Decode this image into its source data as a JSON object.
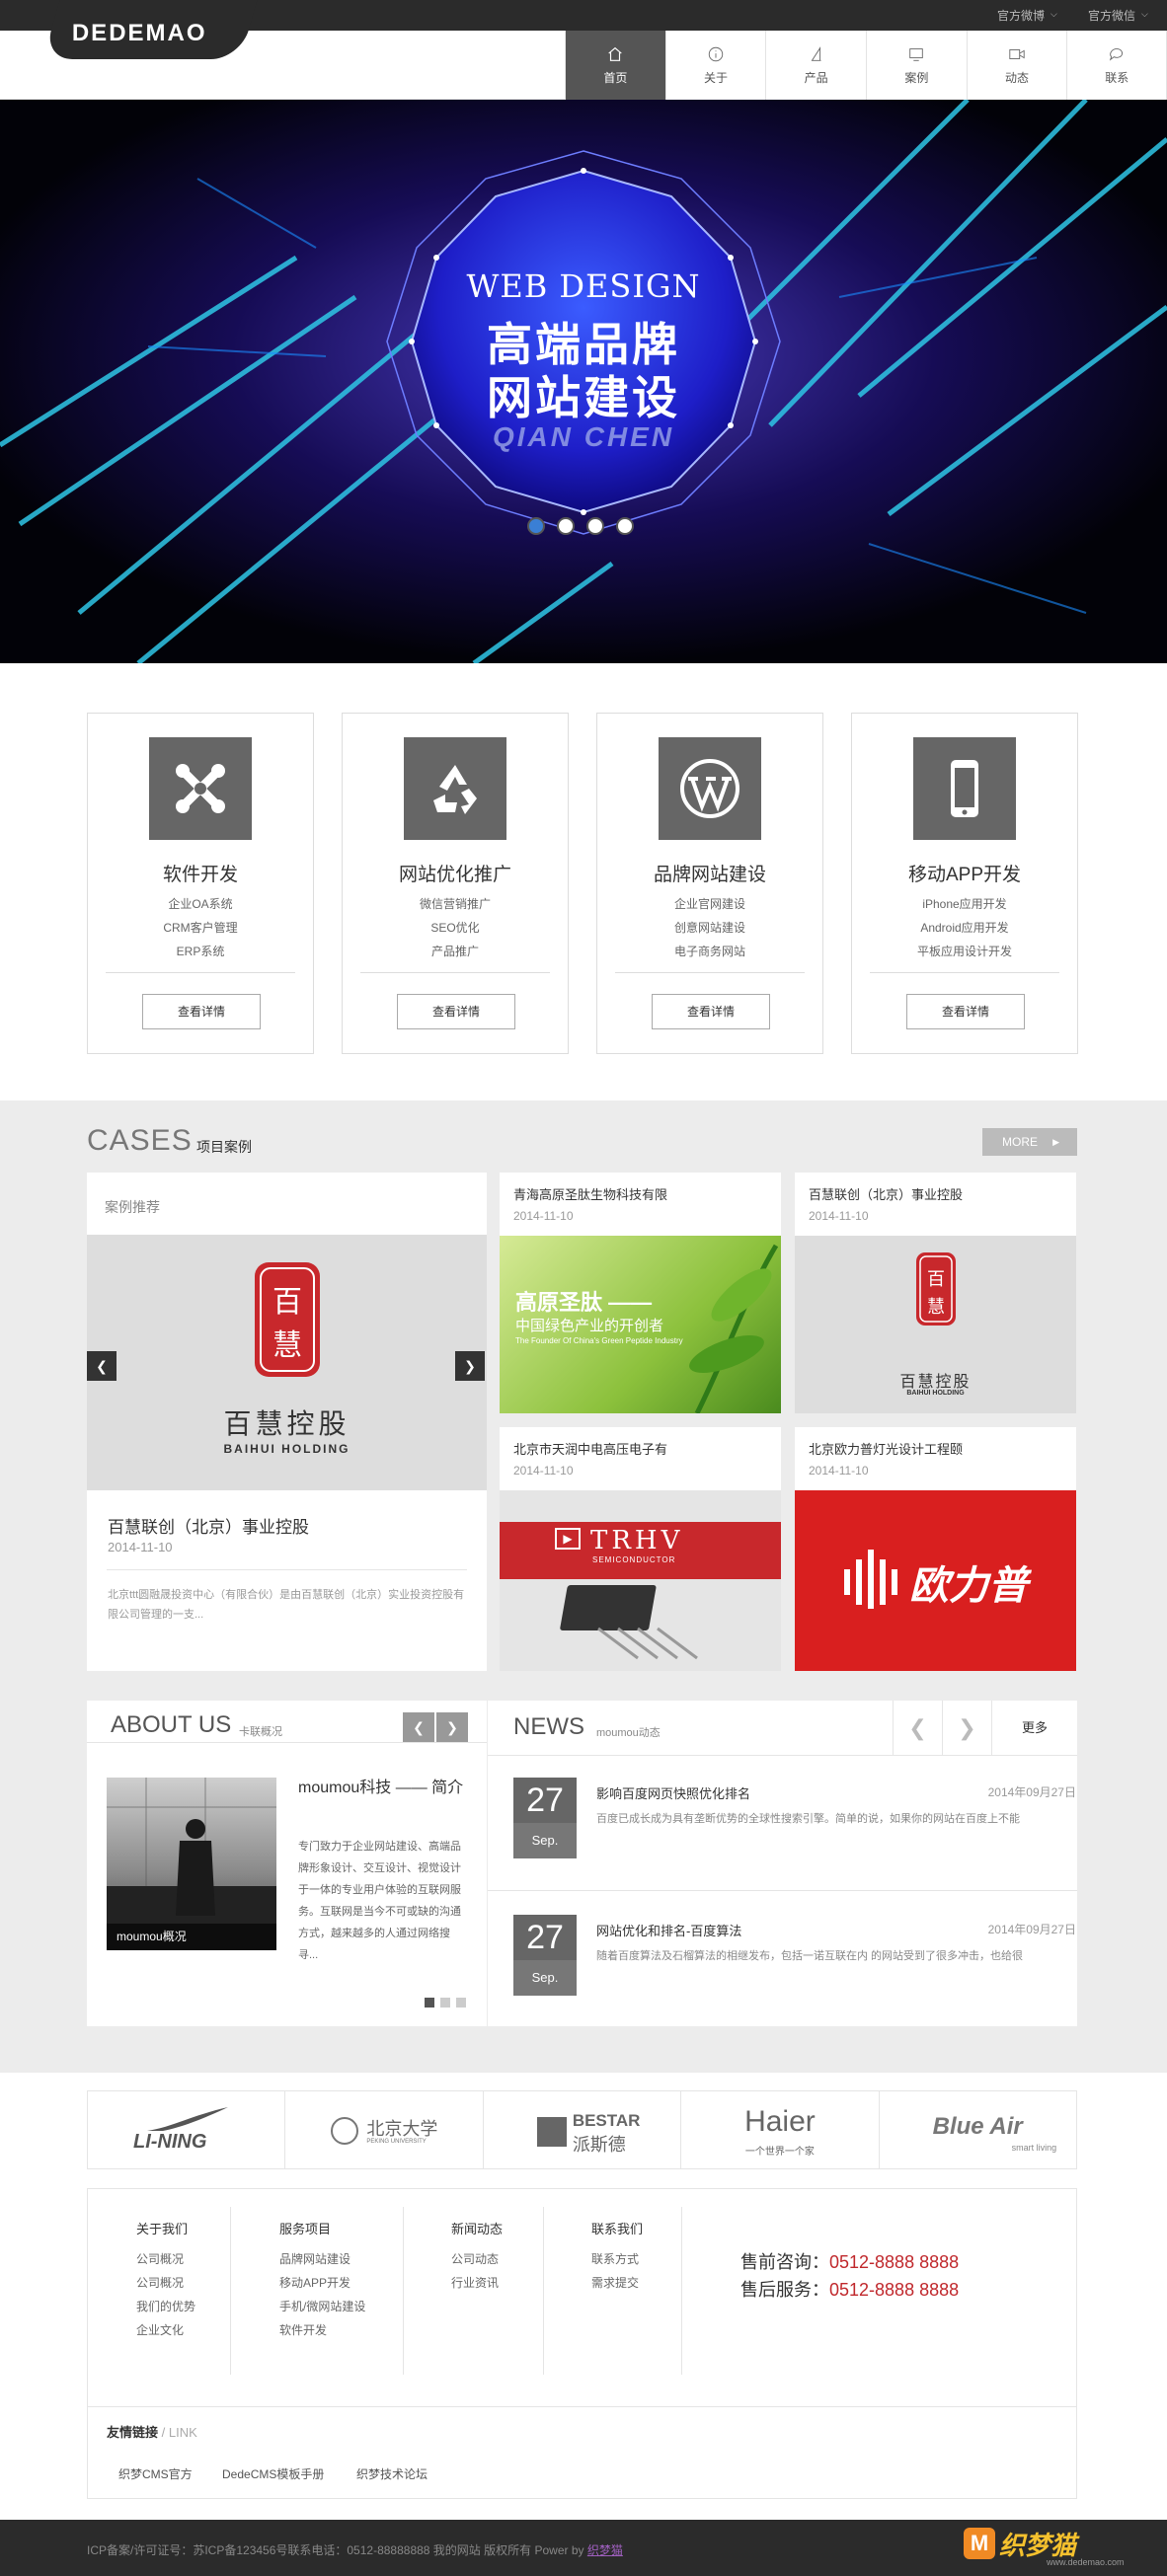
{
  "topbar": {
    "weibo": "官方微博",
    "weixin": "官方微信"
  },
  "logo": {
    "text": "DEDEMAO"
  },
  "nav": [
    {
      "label": "首页",
      "icon": "home-icon"
    },
    {
      "label": "关于",
      "icon": "info-icon"
    },
    {
      "label": "产品",
      "icon": "flag-icon"
    },
    {
      "label": "案例",
      "icon": "monitor-icon"
    },
    {
      "label": "动态",
      "icon": "video-icon"
    },
    {
      "label": "联系",
      "icon": "chat-icon"
    }
  ],
  "banner": {
    "line1": "WEB DESIGN",
    "line2": "高端品牌",
    "line3": "网站建设",
    "line4": "QIAN CHEN",
    "active_slide": 1,
    "slides": 4
  },
  "services": [
    {
      "title": "软件开发",
      "items": [
        "企业OA系统",
        "CRM客户管理",
        "ERP系统"
      ],
      "button": "查看详情",
      "icon": "joomla-icon"
    },
    {
      "title": "网站优化推广",
      "items": [
        "微信营销推广",
        "SEO优化",
        "产品推广"
      ],
      "button": "查看详情",
      "icon": "recycle-icon"
    },
    {
      "title": "品牌网站建设",
      "items": [
        "企业官网建设",
        "创意网站建设",
        "电子商务网站"
      ],
      "button": "查看详情",
      "icon": "wordpress-icon"
    },
    {
      "title": "移动APP开发",
      "items": [
        "iPhone应用开发",
        "Android应用开发",
        "平板应用设计开发"
      ],
      "button": "查看详情",
      "icon": "phone-icon"
    }
  ],
  "cases": {
    "title_en": "CASES",
    "title_cn": "项目案例",
    "more": "MORE",
    "featured_label": "案例推荐",
    "featured": {
      "name": "百慧联创（北京）事业控股",
      "date": "2014-11-10",
      "desc": "北京ttt圆融晟投资中心（有限合伙）是由百慧联创（北京）实业投资控股有限公司管理的一支...",
      "logo_cn": "百慧控股",
      "logo_en": "BAIHUI HOLDING"
    },
    "items": [
      {
        "name": "青海高原圣肽生物科技有限",
        "date": "2014-11-10",
        "img_t1": "高原圣肽 ——",
        "img_t2": "中国绿色产业的开创者",
        "img_t3": "The Founder Of China's Green Peptide Industry"
      },
      {
        "name": "百慧联创（北京）事业控股",
        "date": "2014-11-10",
        "img_t1": "百慧控股",
        "img_t2": "BAIHUI HOLDING"
      },
      {
        "name": "北京市天润中电高压电子有",
        "date": "2014-11-10",
        "img_t1": "TRHV",
        "img_t2": "SEMICONDUCTOR"
      },
      {
        "name": "北京欧力普灯光设计工程颐",
        "date": "2014-11-10",
        "img_t1": "欧力普"
      }
    ]
  },
  "about": {
    "title": "ABOUT US",
    "sub": "卡联概况",
    "heading": "moumou科技 —— 简介",
    "caption": "moumou概况",
    "text": "专门致力于企业网站建设、高端品牌形象设计、交互设计、视觉设计于一体的专业用户体验的互联网服务。互联网是当今不可或缺的沟通方式，越来越多的人通过网络搜寻..."
  },
  "news": {
    "title": "NEWS",
    "sub": "moumou动态",
    "more": "更多",
    "items": [
      {
        "day": "27",
        "mon": "Sep.",
        "title": "影响百度网页快照优化排名",
        "date": "2014年09月27日",
        "desc": "百度已成长成为具有垄断优势的全球性搜索引擎。简单的说，如果你的网站在百度上不能"
      },
      {
        "day": "27",
        "mon": "Sep.",
        "title": "网站优化和排名-百度算法",
        "date": "2014年09月27日",
        "desc": "随着百度算法及石榴算法的相继发布，包括一诺互联在内 的网站受到了很多冲击，也给很"
      }
    ]
  },
  "partners": [
    {
      "name": "LI-NING"
    },
    {
      "name": "北京大学",
      "sub": "PEKING UNIVERSITY"
    },
    {
      "name": "BESTAR",
      "sub": "派斯德"
    },
    {
      "name": "Haier",
      "sub": "一个世界一个家"
    },
    {
      "name": "Blue Air",
      "sub": "smart living"
    }
  ],
  "footer": {
    "cols": [
      {
        "h": "关于我们",
        "items": [
          "公司概况",
          "公司概况",
          "我们的优势",
          "企业文化"
        ]
      },
      {
        "h": "服务项目",
        "items": [
          "品牌网站建设",
          "移动APP开发",
          "手机/微网站建设",
          "软件开发"
        ]
      },
      {
        "h": "新闻动态",
        "items": [
          "公司动态",
          "行业资讯"
        ]
      },
      {
        "h": "联系我们",
        "items": [
          "联系方式",
          "需求提交"
        ]
      }
    ],
    "pre_label": "售前咨询：",
    "pre_phone": "0512-8888 8888",
    "post_label": "售后服务：",
    "post_phone": "0512-8888 8888",
    "links_title": "友情链接",
    "links_sub": "/ LINK",
    "links": [
      "织梦CMS官方",
      "DedeCMS模板手册",
      "织梦技术论坛"
    ],
    "copyright": "ICP备案/许可证号：苏ICP备123456号联系电话：0512-88888888 我的网站 版权所有 Power by",
    "power_link": "织梦猫",
    "watermark": "织梦猫",
    "watermark_url": "www.dedemao.com"
  }
}
